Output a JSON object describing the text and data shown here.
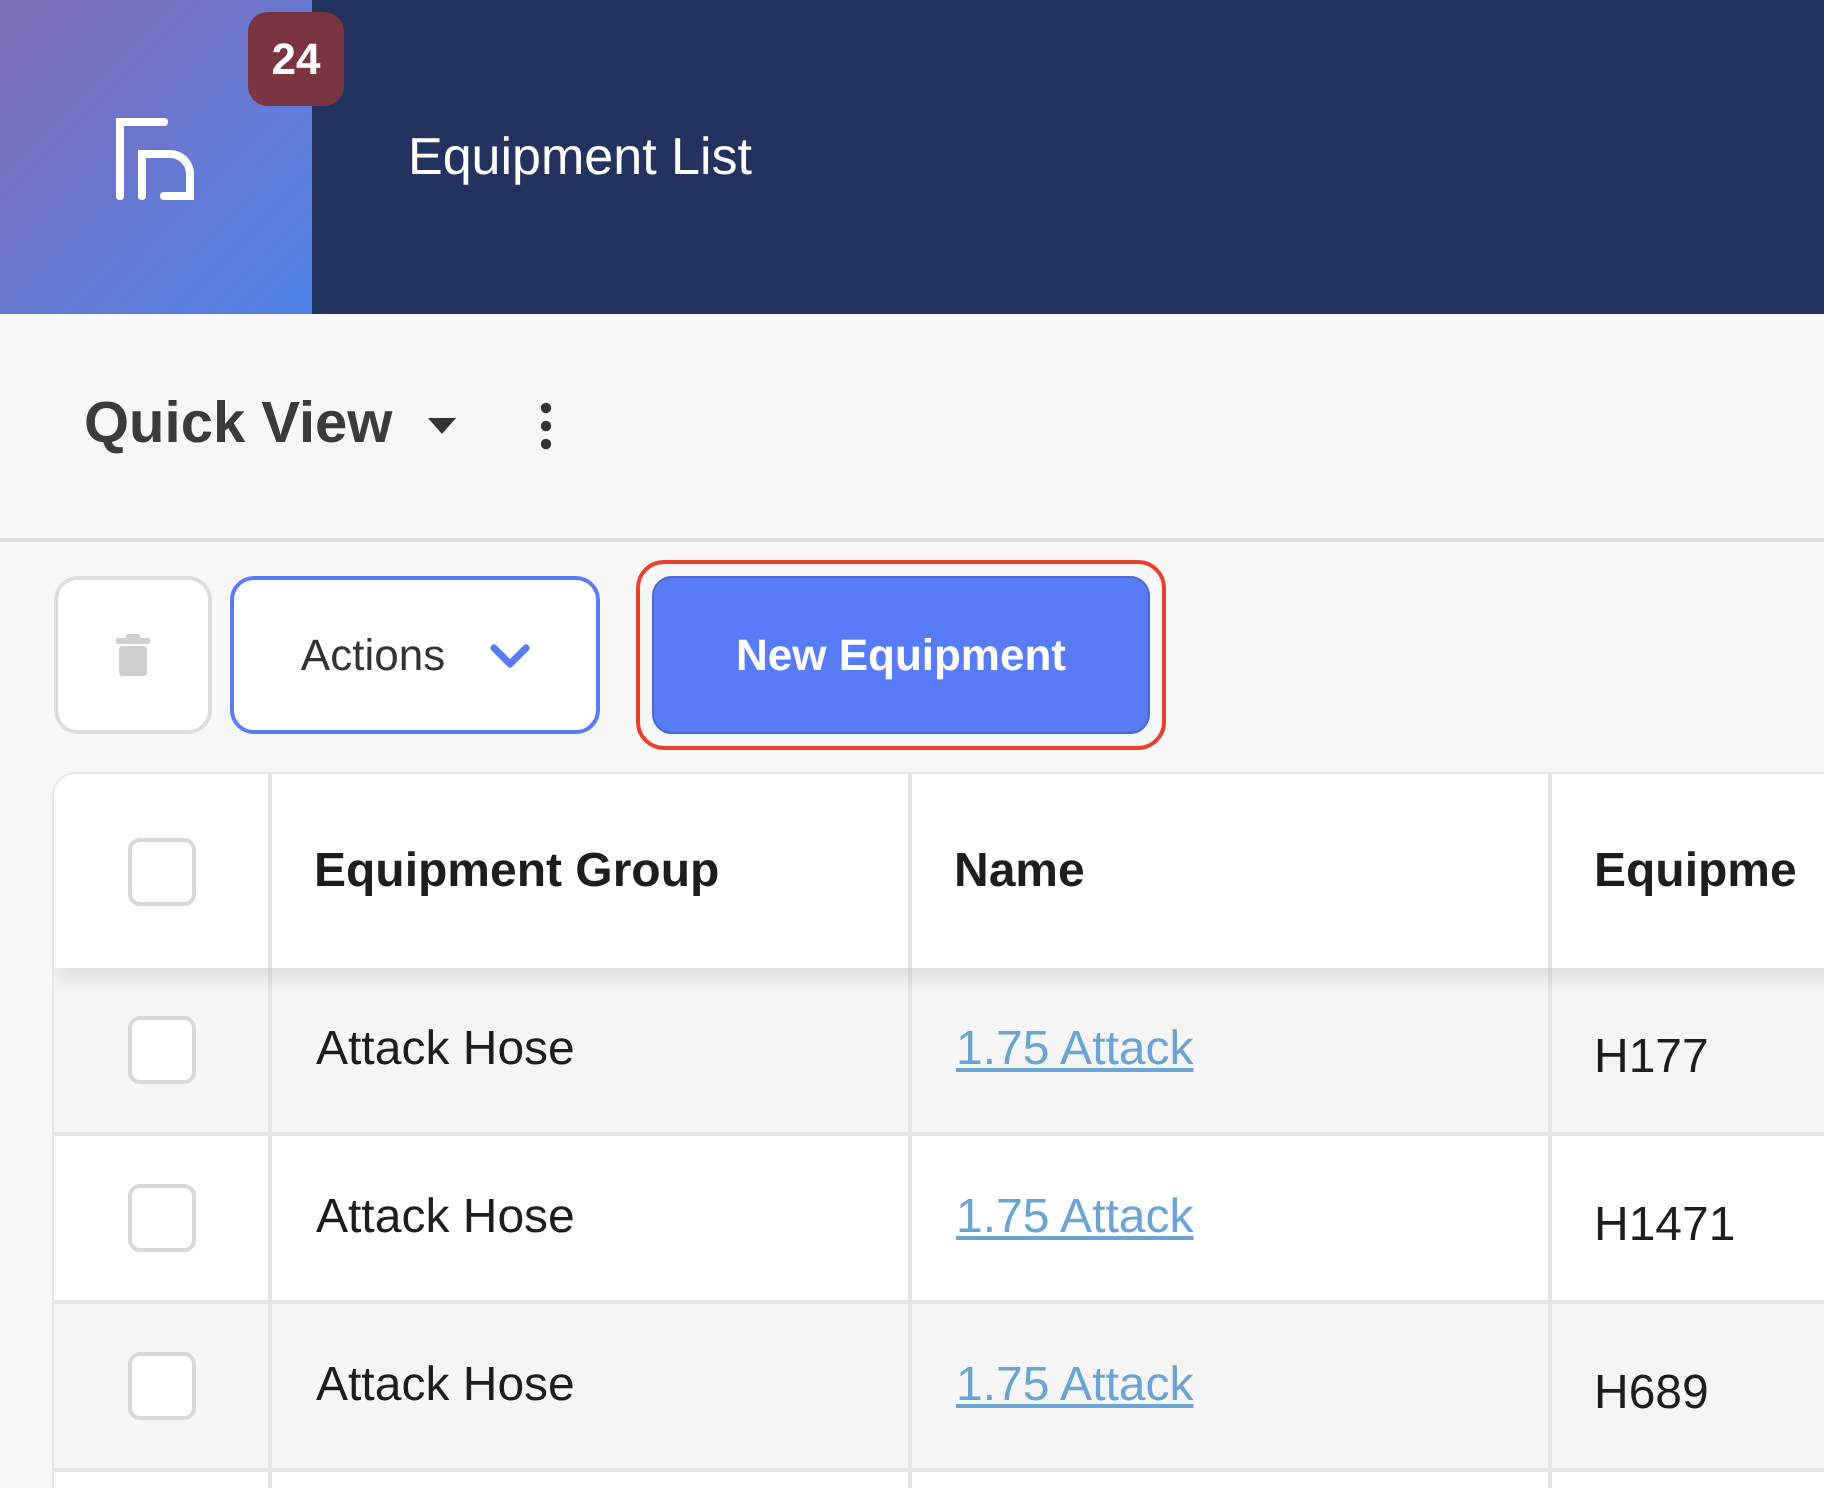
{
  "header": {
    "badge": "24",
    "title": "Equipment List"
  },
  "view_bar": {
    "title": "Quick View"
  },
  "toolbar": {
    "actions_label": "Actions",
    "new_button": {
      "label": "New Equipment",
      "focused": true
    }
  },
  "table": {
    "columns": [
      {
        "label": "Equipment Group"
      },
      {
        "label": "Name"
      },
      {
        "label": "Equipme"
      }
    ],
    "header_checked": false,
    "rows": [
      {
        "checked": false,
        "group": "Attack Hose",
        "name": "1.75 Attack",
        "column_3": "H177"
      },
      {
        "checked": false,
        "group": "Attack Hose",
        "name": "1.75 Attack",
        "column_3": "H1471"
      },
      {
        "checked": false,
        "group": "Attack Hose",
        "name": "1.75 Attack",
        "column_3": "H689"
      }
    ]
  }
}
